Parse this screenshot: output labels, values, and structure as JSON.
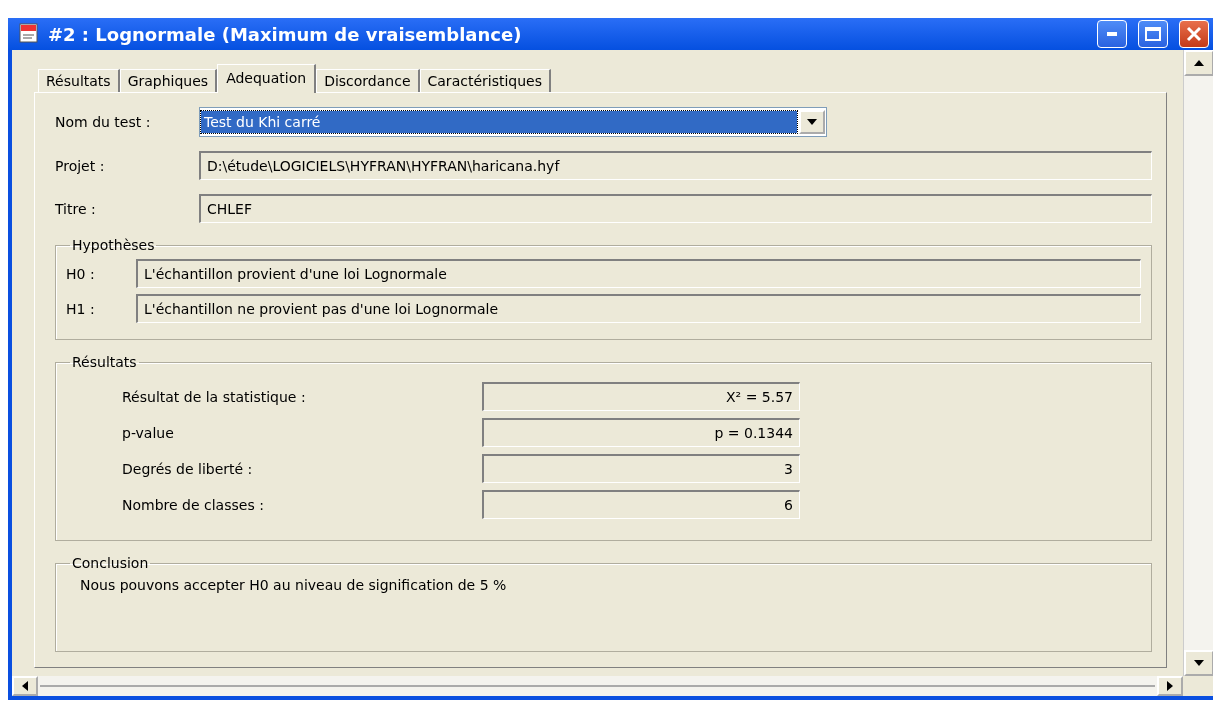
{
  "window": {
    "title": "#2 : Lognormale (Maximum de vraisemblance)"
  },
  "tabs": [
    {
      "label": "Résultats",
      "selected": false
    },
    {
      "label": "Graphiques",
      "selected": false
    },
    {
      "label": "Adequation",
      "selected": true
    },
    {
      "label": "Discordance",
      "selected": false
    },
    {
      "label": "Caractéristiques",
      "selected": false
    }
  ],
  "test": {
    "label": "Nom du test :",
    "value": "Test du Khi carré"
  },
  "project": {
    "label": "Projet :",
    "value": "D:\\étude\\LOGICIELS\\HYFRAN\\HYFRAN\\haricana.hyf"
  },
  "title_field": {
    "label": "Titre :",
    "value": "CHLEF"
  },
  "hypotheses": {
    "legend": "Hypothèses",
    "items": [
      {
        "label": "H0 :",
        "value": "L'échantillon provient d'une loi Lognormale"
      },
      {
        "label": "H1 :",
        "value": "L'échantillon ne provient pas d'une loi Lognormale"
      }
    ]
  },
  "results": {
    "legend": "Résultats",
    "items": [
      {
        "label": "Résultat de la statistique :",
        "value": "X² = 5.57"
      },
      {
        "label": "p-value",
        "value": "p = 0.1344"
      },
      {
        "label": "Degrés de liberté :",
        "value": "3"
      },
      {
        "label": "Nombre de classes :",
        "value": "6"
      }
    ]
  },
  "conclusion": {
    "legend": "Conclusion",
    "text": "Nous pouvons accepter H0 au niveau de signification de 5 %"
  }
}
